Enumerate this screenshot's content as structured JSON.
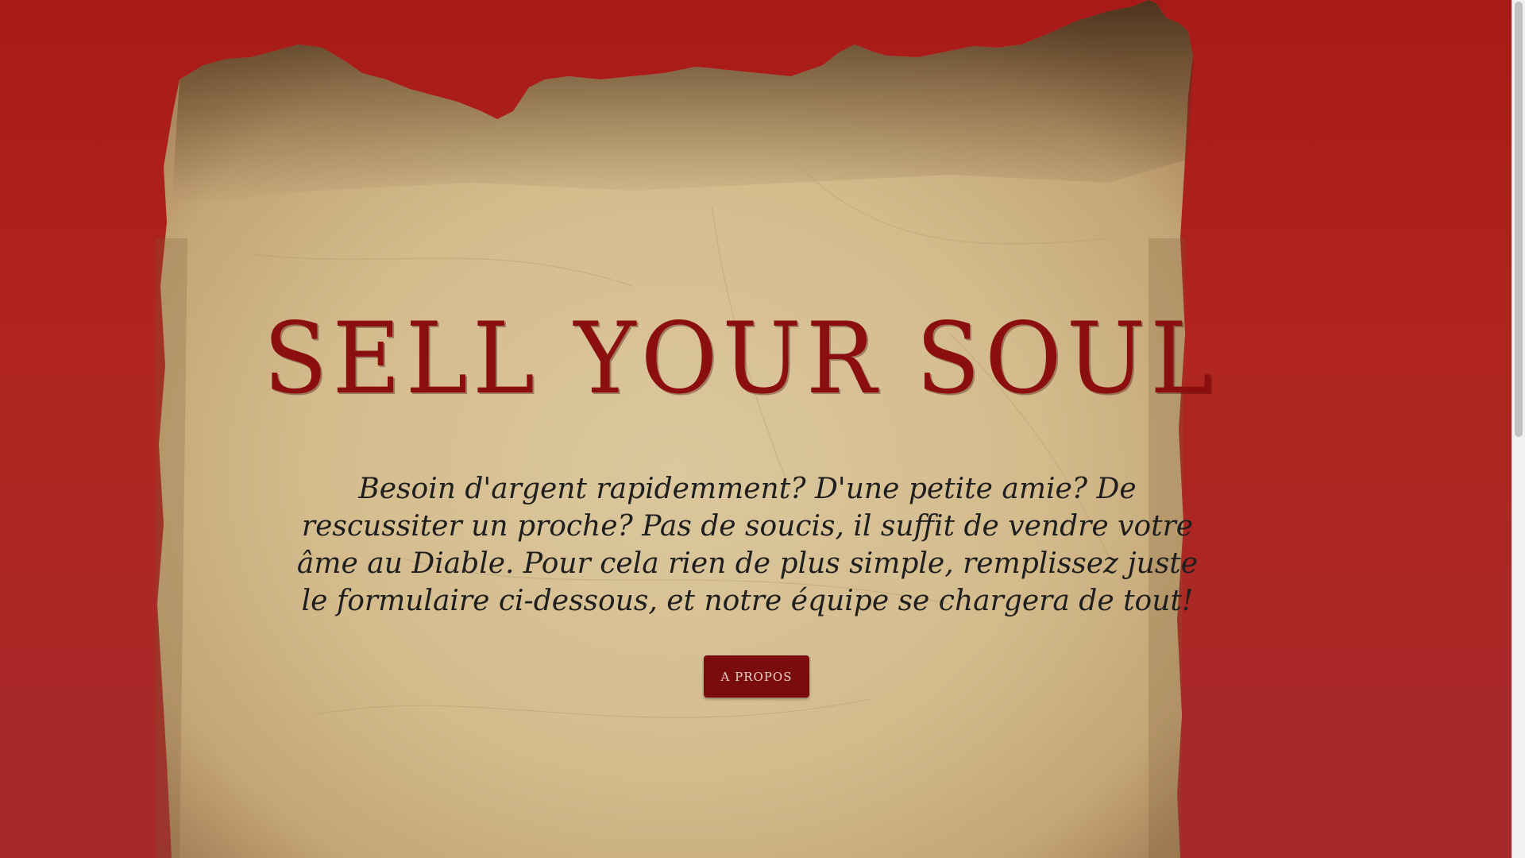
{
  "hero": {
    "title": "SELL YOUR SOUL",
    "description": "Besoin d'argent rapidemment? D'une petite amie? De rescussiter un proche? Pas de soucis, il suffit de vendre votre âme au Diable. Pour cela rien de plus simple, remplissez juste le formulaire ci-dessous, et notre équipe se chargera de tout!",
    "button_label": "A PROPOS"
  },
  "colors": {
    "background": "#a81a17",
    "title": "#8c0f0f",
    "button": "#7a0c0e",
    "parchment": "#d9c49a"
  }
}
